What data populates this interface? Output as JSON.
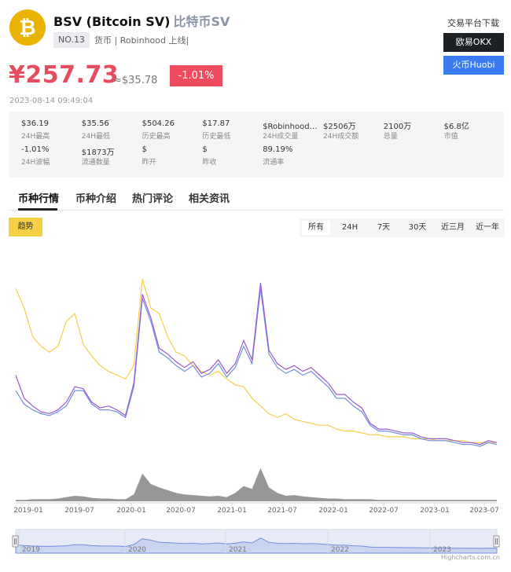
{
  "coin": {
    "name": "BSV (Bitcoin SV)",
    "cn_name": "比特币SV",
    "rank": "NO.13",
    "tags": "货币 | Robinhood 上线|",
    "price": "¥257.73",
    "usd_price": "≈$35.78",
    "change": "-1.01%",
    "timestamp": "2023-08-14 09:49:04"
  },
  "exchanges": {
    "title": "交易平台下载",
    "okx": "欧易OKX",
    "huobi": "火币Huobi"
  },
  "stats": [
    {
      "value": "$36.19",
      "label": "24H最高"
    },
    {
      "value": "$35.56",
      "label": "24H最低"
    },
    {
      "value": "$504.26",
      "label": "历史最高"
    },
    {
      "value": "$17.87",
      "label": "历史最低"
    },
    {
      "value": "$Robinhood上线",
      "label": "24H成交量"
    },
    {
      "value": "$2506万",
      "label": "24H成交额"
    },
    {
      "value": "2100万",
      "label": "总量"
    },
    {
      "value": "$6.8亿",
      "label": "市值"
    },
    {
      "value": "-1.01%",
      "label": "24H波幅"
    },
    {
      "value": "$1873万",
      "label": "流通数量"
    },
    {
      "value": "$",
      "label": "昨开"
    },
    {
      "value": "$",
      "label": "昨收"
    },
    {
      "value": "89.19%",
      "label": "流通率"
    }
  ],
  "tabs": [
    "币种行情",
    "币种介绍",
    "热门评论",
    "相关资讯"
  ],
  "trend_label": "趋势",
  "ranges": [
    "所有",
    "24H",
    "7天",
    "30天",
    "近三月",
    "近一年"
  ],
  "colors": {
    "price_red": "#e74c5e",
    "purple_series": "#9b59d0",
    "blue_series": "#6f8fe0",
    "yellow_series": "#f4cf4c",
    "volume": "#8c8c8c",
    "navigator": "#6f8fe0"
  },
  "credit": "Highcharts.com.cn",
  "chart_data": {
    "type": "line",
    "x_ticks": [
      "2019-01",
      "2019-07",
      "2020-01",
      "2020-07",
      "2021-01",
      "2021-07",
      "2022-01",
      "2022-07",
      "2023-01",
      "2023-07"
    ],
    "navigator_ticks": [
      "2019",
      "2020",
      "2021",
      "2022",
      "2023"
    ],
    "x": [
      "2018-11",
      "2018-12",
      "2019-01",
      "2019-02",
      "2019-03",
      "2019-04",
      "2019-05",
      "2019-06",
      "2019-07",
      "2019-08",
      "2019-09",
      "2019-10",
      "2019-11",
      "2019-12",
      "2020-01",
      "2020-02",
      "2020-03",
      "2020-04",
      "2020-05",
      "2020-06",
      "2020-07",
      "2020-08",
      "2020-09",
      "2020-10",
      "2020-11",
      "2020-12",
      "2021-01",
      "2021-02",
      "2021-03",
      "2021-04",
      "2021-05",
      "2021-06",
      "2021-07",
      "2021-08",
      "2021-09",
      "2021-10",
      "2021-11",
      "2021-12",
      "2022-01",
      "2022-02",
      "2022-03",
      "2022-04",
      "2022-05",
      "2022-06",
      "2022-07",
      "2022-08",
      "2022-09",
      "2022-10",
      "2022-11",
      "2022-12",
      "2023-01",
      "2023-02",
      "2023-03",
      "2023-04",
      "2023-05",
      "2023-06",
      "2023-07",
      "2023-08"
    ],
    "series": [
      {
        "values": [
          0.5,
          0.38,
          0.34,
          0.31,
          0.3,
          0.32,
          0.36,
          0.44,
          0.43,
          0.36,
          0.33,
          0.34,
          0.32,
          0.29,
          0.46,
          0.92,
          0.8,
          0.64,
          0.61,
          0.57,
          0.54,
          0.57,
          0.51,
          0.53,
          0.58,
          0.51,
          0.56,
          0.68,
          0.58,
          0.98,
          0.63,
          0.56,
          0.53,
          0.55,
          0.52,
          0.54,
          0.5,
          0.46,
          0.4,
          0.4,
          0.36,
          0.33,
          0.25,
          0.22,
          0.22,
          0.21,
          0.2,
          0.2,
          0.18,
          0.17,
          0.17,
          0.17,
          0.16,
          0.15,
          0.15,
          0.14,
          0.16,
          0.15
        ]
      },
      {
        "values": [
          0.42,
          0.35,
          0.32,
          0.3,
          0.29,
          0.31,
          0.34,
          0.42,
          0.42,
          0.35,
          0.32,
          0.32,
          0.31,
          0.28,
          0.44,
          0.9,
          0.78,
          0.62,
          0.59,
          0.55,
          0.52,
          0.55,
          0.49,
          0.51,
          0.56,
          0.49,
          0.54,
          0.65,
          0.56,
          0.95,
          0.61,
          0.54,
          0.51,
          0.53,
          0.5,
          0.52,
          0.48,
          0.44,
          0.38,
          0.38,
          0.34,
          0.31,
          0.24,
          0.21,
          0.21,
          0.2,
          0.19,
          0.19,
          0.17,
          0.16,
          0.16,
          0.16,
          0.15,
          0.14,
          0.14,
          0.13,
          0.15,
          0.14
        ]
      },
      {
        "values": [
          0.95,
          0.85,
          0.7,
          0.65,
          0.62,
          0.65,
          0.78,
          0.82,
          0.66,
          0.6,
          0.55,
          0.52,
          0.5,
          0.48,
          0.55,
          1.0,
          0.85,
          0.82,
          0.7,
          0.62,
          0.6,
          0.55,
          0.52,
          0.5,
          0.52,
          0.48,
          0.45,
          0.44,
          0.38,
          0.34,
          0.3,
          0.28,
          0.3,
          0.27,
          0.26,
          0.25,
          0.24,
          0.24,
          0.22,
          0.21,
          0.21,
          0.2,
          0.19,
          0.19,
          0.18,
          0.18,
          0.18,
          0.17,
          0.17,
          0.17,
          0.16,
          0.16,
          0.16,
          0.16,
          0.15,
          0.15,
          0.15,
          0.15
        ]
      },
      {
        "values": [
          0.02,
          0.02,
          0.03,
          0.03,
          0.03,
          0.04,
          0.06,
          0.08,
          0.07,
          0.05,
          0.04,
          0.04,
          0.03,
          0.03,
          0.1,
          0.4,
          0.25,
          0.2,
          0.16,
          0.12,
          0.1,
          0.09,
          0.08,
          0.07,
          0.08,
          0.06,
          0.12,
          0.22,
          0.18,
          0.48,
          0.2,
          0.12,
          0.08,
          0.09,
          0.07,
          0.06,
          0.05,
          0.04,
          0.04,
          0.03,
          0.03,
          0.03,
          0.03,
          0.02,
          0.02,
          0.02,
          0.02,
          0.02,
          0.02,
          0.02,
          0.02,
          0.02,
          0.02,
          0.02,
          0.02,
          0.02,
          0.02,
          0.02
        ]
      }
    ],
    "navigator_values": [
      0.42,
      0.35,
      0.32,
      0.3,
      0.29,
      0.31,
      0.34,
      0.42,
      0.42,
      0.35,
      0.32,
      0.32,
      0.31,
      0.28,
      0.44,
      0.9,
      0.78,
      0.62,
      0.59,
      0.55,
      0.52,
      0.55,
      0.49,
      0.51,
      0.56,
      0.49,
      0.54,
      0.65,
      0.56,
      0.95,
      0.61,
      0.54,
      0.51,
      0.53,
      0.5,
      0.52,
      0.48,
      0.44,
      0.38,
      0.38,
      0.34,
      0.31,
      0.24,
      0.21,
      0.21,
      0.2,
      0.19,
      0.19,
      0.17,
      0.16,
      0.16,
      0.16,
      0.15,
      0.14,
      0.14,
      0.13,
      0.15,
      0.14
    ],
    "grid": false,
    "legend": "none"
  }
}
